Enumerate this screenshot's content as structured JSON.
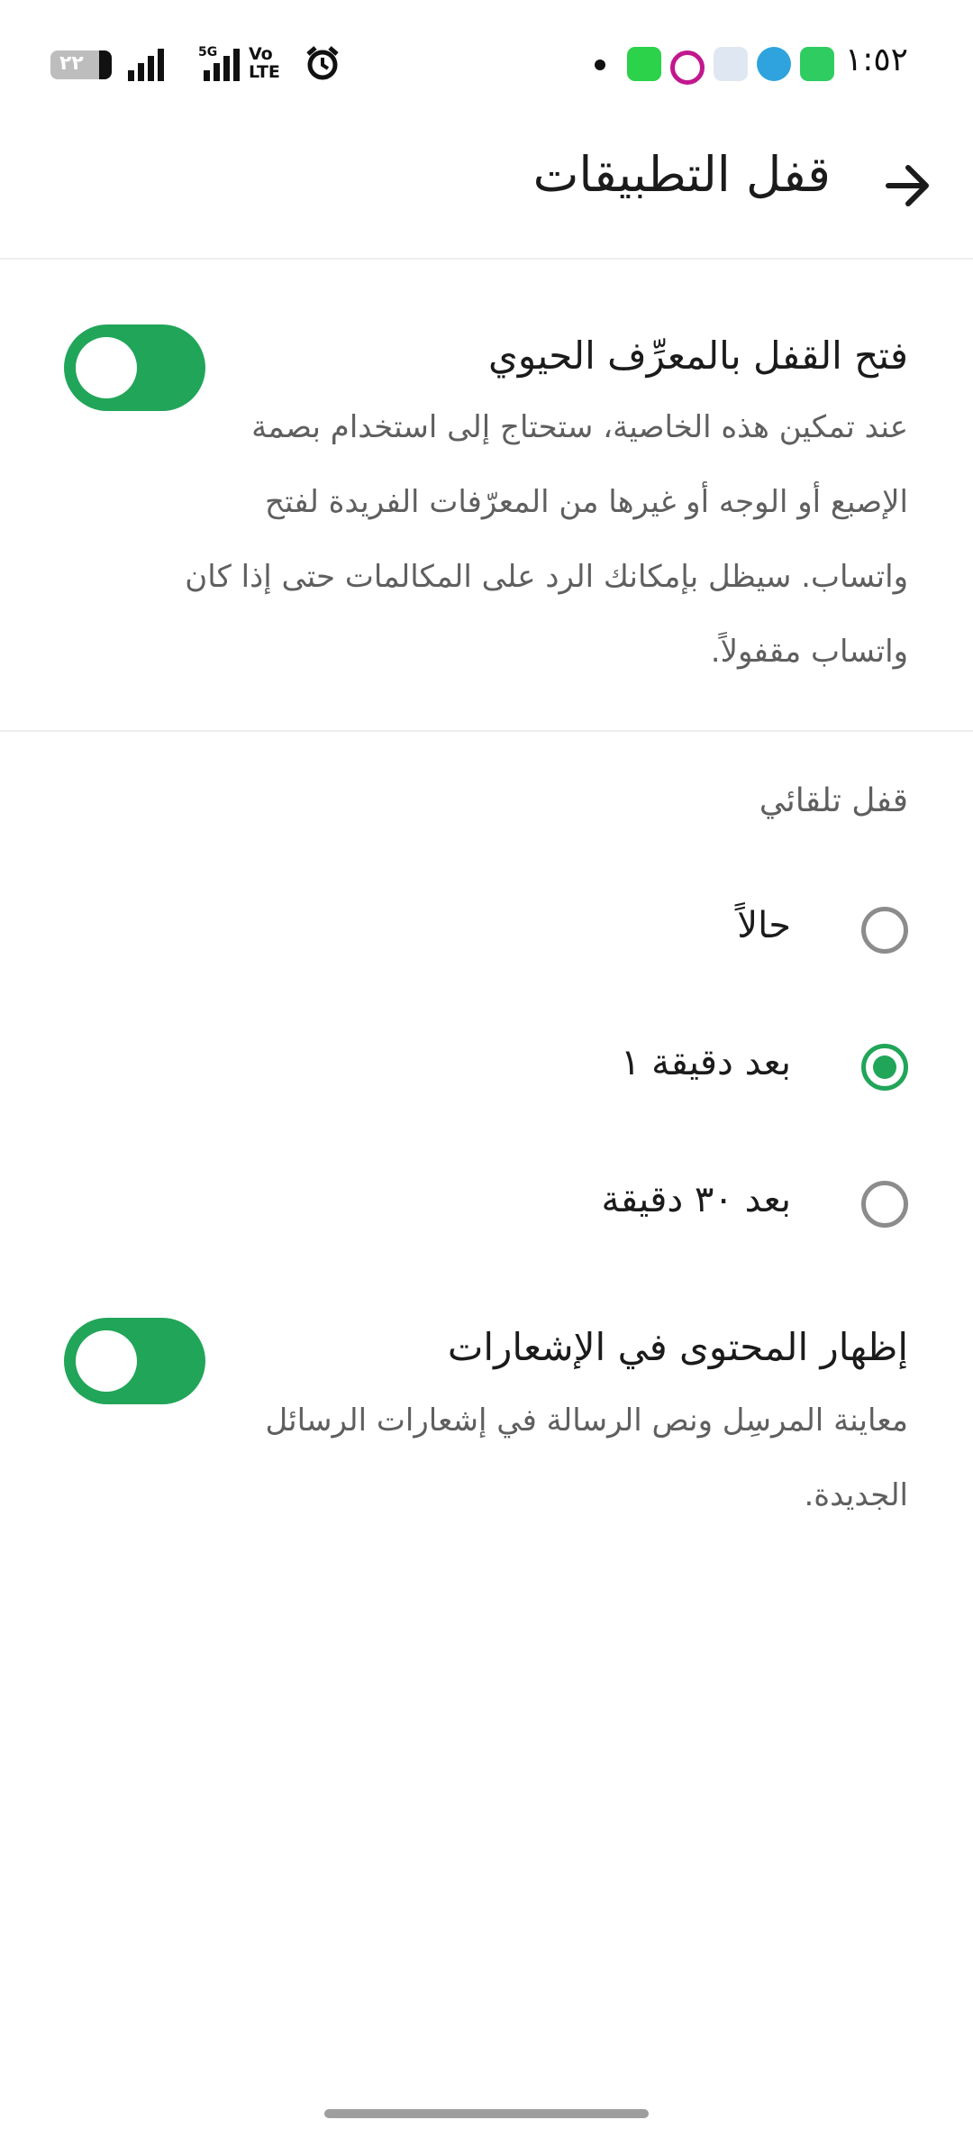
{
  "status_bar": {
    "time": "١:٥٢",
    "battery_level": "٢٢",
    "network": "5G",
    "volte": "Vo\nLTE2",
    "icons": [
      "whatsapp-icon",
      "telegram-icon",
      "app-icon",
      "app-icon",
      "app-icon",
      "notification-dot-icon",
      "alarm-icon",
      "signal-icon"
    ]
  },
  "header": {
    "title": "قفل التطبيقات",
    "back_icon": "arrow-right-icon"
  },
  "biometric": {
    "title": "فتح القفل بالمعرِّف الحيوي",
    "description": "عند تمكين هذه الخاصية، ستحتاج إلى استخدام بصمة الإصبع أو الوجه أو غيرها من المعرّفات الفريدة لفتح واتساب. سيظل بإمكانك الرد على المكالمات حتى إذا كان واتساب مقفولاً.",
    "enabled": true
  },
  "auto_lock": {
    "label": "قفل تلقائي",
    "options": [
      {
        "label": "حالاً",
        "selected": false
      },
      {
        "label": "بعد دقيقة ١",
        "selected": true
      },
      {
        "label": "بعد ٣٠ دقيقة",
        "selected": false
      }
    ]
  },
  "notifications": {
    "title": "إظهار المحتوى في الإشعارات",
    "description": "معاينة المرسِل ونص الرسالة في إشعارات الرسائل الجديدة.",
    "enabled": true
  },
  "colors": {
    "accent": "#21a559",
    "text": "#1b1b1b",
    "secondary_text": "#5f5f5f"
  }
}
